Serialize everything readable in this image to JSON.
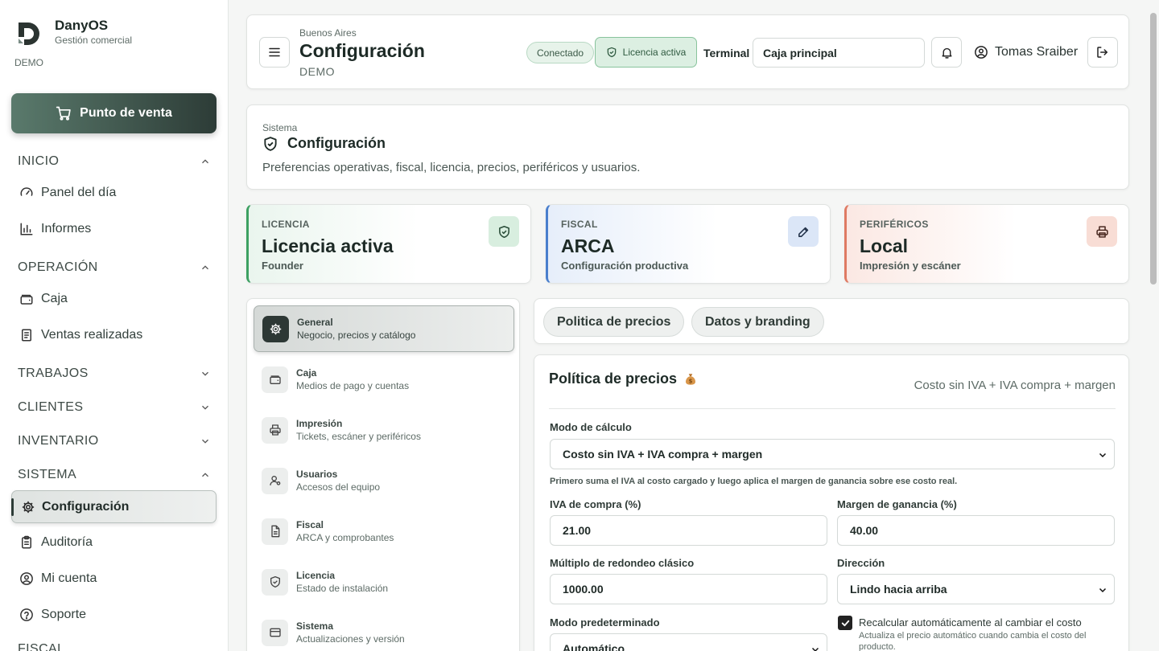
{
  "brand": {
    "name": "DanyOS",
    "subtitle": "Gestión comercial",
    "env": "DEMO"
  },
  "sidebar": {
    "pos_button": "Punto de venta",
    "sections": {
      "inicio": {
        "label": "INICIO",
        "items": [
          "Panel del día",
          "Informes"
        ]
      },
      "operacion": {
        "label": "OPERACIÓN",
        "items": [
          "Caja",
          "Ventas realizadas"
        ]
      },
      "trabajos": {
        "label": "TRABAJOS"
      },
      "clientes": {
        "label": "CLIENTES"
      },
      "inventario": {
        "label": "INVENTARIO"
      },
      "sistema": {
        "label": "SISTEMA",
        "items": [
          "Configuración",
          "Auditoría",
          "Mi cuenta",
          "Soporte"
        ]
      },
      "fiscal": {
        "label": "FISCAL"
      }
    }
  },
  "header": {
    "city": "Buenos Aires",
    "title": "Configuración",
    "env": "DEMO",
    "status_pill": "Conectado",
    "license_pill": "Licencia activa",
    "terminal_label": "Terminal",
    "terminal_value": "Caja principal",
    "user_name": "Tomas Sraiber"
  },
  "system_card": {
    "eyebrow": "Sistema",
    "title": "Configuración",
    "description": "Preferencias operativas, fiscal, licencia, precios, periféricos y usuarios."
  },
  "stats": [
    {
      "eyebrow": "LICENCIA",
      "value": "Licencia activa",
      "sub": "Founder",
      "icon": "shield-check-icon",
      "color": "#3da062"
    },
    {
      "eyebrow": "FISCAL",
      "value": "ARCA",
      "sub": "Configuración productiva",
      "icon": "pencil-icon",
      "color": "#4a7fcd"
    },
    {
      "eyebrow": "PERIFÉRICOS",
      "value": "Local",
      "sub": "Impresión y escáner",
      "icon": "printer-icon",
      "color": "#df7a63"
    }
  ],
  "settings_nav": [
    {
      "title": "General",
      "subtitle": "Negocio, precios y catálogo",
      "icon": "gear-icon"
    },
    {
      "title": "Caja",
      "subtitle": "Medios de pago y cuentas",
      "icon": "wallet-icon"
    },
    {
      "title": "Impresión",
      "subtitle": "Tickets, escáner y periféricos",
      "icon": "printer-icon"
    },
    {
      "title": "Usuarios",
      "subtitle": "Accesos del equipo",
      "icon": "users-icon"
    },
    {
      "title": "Fiscal",
      "subtitle": "ARCA y comprobantes",
      "icon": "document-icon"
    },
    {
      "title": "Licencia",
      "subtitle": "Estado de instalación",
      "icon": "shield-check-icon"
    },
    {
      "title": "Sistema",
      "subtitle": "Actualizaciones y versión",
      "icon": "card-icon"
    }
  ],
  "tabs": [
    "Politica de precios",
    "Datos y branding"
  ],
  "pricing": {
    "title": "Política de precios",
    "emoji": "money-bag-icon",
    "summary": "Costo sin IVA + IVA compra + margen",
    "mode_label": "Modo de cálculo",
    "mode_value": "Costo sin IVA + IVA compra + margen",
    "mode_hint": "Primero suma el IVA al costo cargado y luego aplica el margen de ganancia sobre ese costo real.",
    "iva_label": "IVA de compra (%)",
    "iva_value": "21.00",
    "margin_label": "Margen de ganancia (%)",
    "margin_value": "40.00",
    "rounding_label": "Múltiplo de redondeo clásico",
    "rounding_value": "1000.00",
    "direction_label": "Dirección",
    "direction_value": "Lindo hacia arriba",
    "default_mode_label": "Modo predeterminado",
    "default_mode_value": "Automático",
    "recalc_label": "Recalcular automáticamente al cambiar el costo",
    "recalc_hint": "Actualiza el precio automático cuando cambia el costo del producto.",
    "recalc_checked": true
  }
}
